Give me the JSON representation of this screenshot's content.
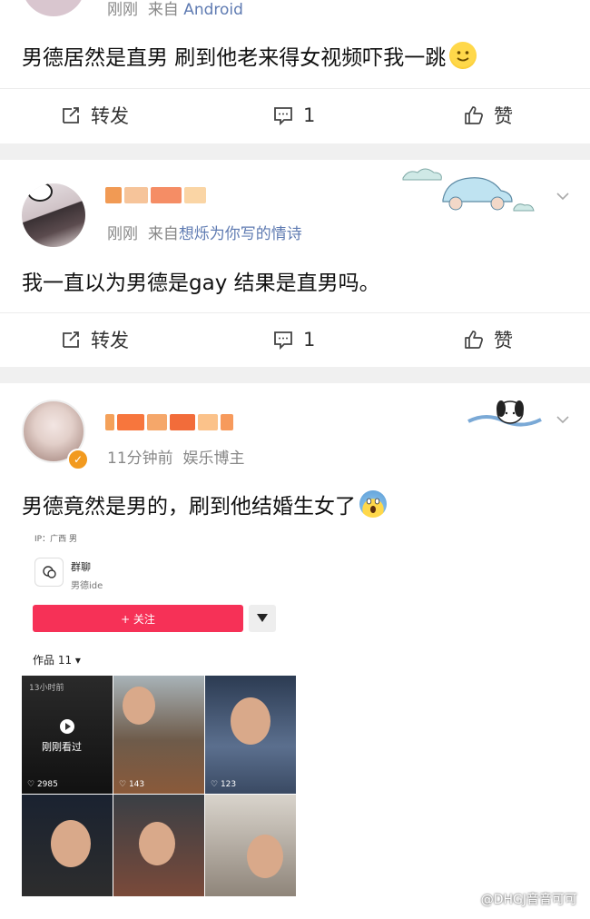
{
  "post1": {
    "meta_time": "刚刚",
    "meta_from": "来自",
    "meta_source": "Android",
    "text": "男德居然是直男 刷到他老来得女视频吓我一跳",
    "emoji": "smile-emoji",
    "repost_label": "转发",
    "comment_count": "1",
    "like_label": "赞"
  },
  "post2": {
    "meta_time": "刚刚",
    "meta_from": "来自",
    "meta_source": "想烁为你写的情诗",
    "text": "我一直以为男德是gay 结果是直男吗。",
    "repost_label": "转发",
    "comment_count": "1",
    "like_label": "赞"
  },
  "post3": {
    "meta_time": "11分钟前",
    "meta_tag": "娱乐博主",
    "text": "男德竟然是男的，刷到他结婚生女了",
    "emoji": "scream-emoji",
    "card": {
      "ip": "IP：广西   男",
      "group_label": "群聊",
      "handle": "男德ide",
      "follow_label": "+ 关注",
      "works_label": "作品 11 ▾",
      "first_tile_time": "13小时前",
      "first_tile_seen": "刚刚看过",
      "likes": [
        "2985",
        "143",
        "123"
      ]
    }
  },
  "watermark": "@DHGJ音音可可",
  "colors": {
    "source_link": "#5f7bb2",
    "follow_button": "#f63157",
    "separator": "#f0f0f0"
  }
}
